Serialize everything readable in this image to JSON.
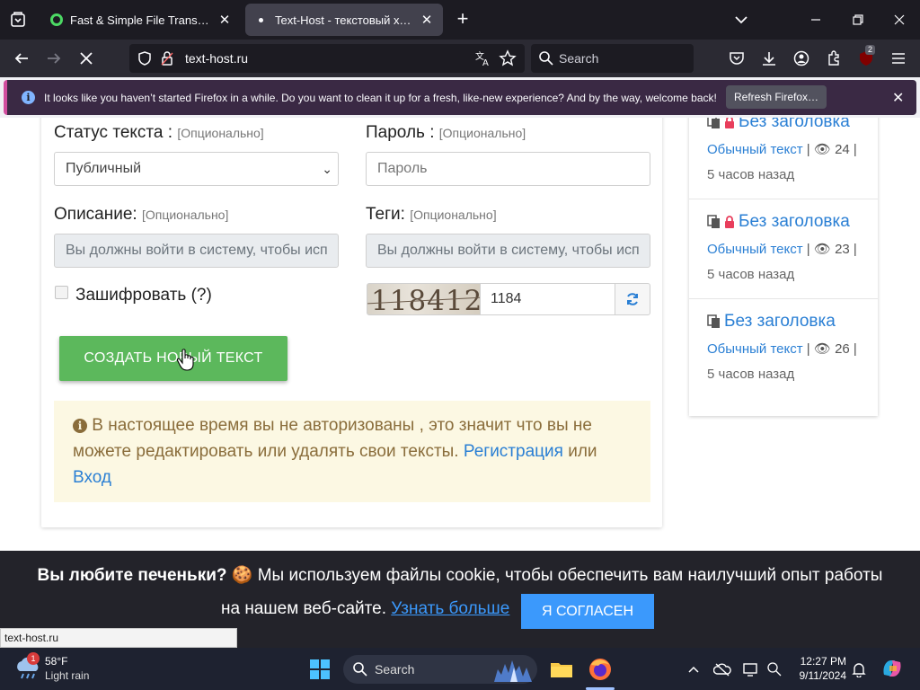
{
  "browser": {
    "tabs": [
      {
        "title": "Fast & Simple File Transfers - Fi",
        "active": false
      },
      {
        "title": "Text-Host - текстовый хостинг",
        "active": true
      }
    ],
    "url": "text-host.ru",
    "search_placeholder": "Search",
    "extension_badge": "2",
    "notification": {
      "message": "It looks like you haven’t started Firefox in a while. Do you want to clean it up for a fresh, like-new experience? And by the way, welcome back!",
      "button": "Refresh Firefox…"
    },
    "status_url": "text-host.ru"
  },
  "form": {
    "status_label": "Статус текста :",
    "status_optional": "[Опционально]",
    "status_value": "Публичный",
    "password_label": "Пароль :",
    "password_optional": "[Опционально]",
    "password_placeholder": "Пароль",
    "description_label": "Описание:",
    "description_optional": "[Опционально]",
    "description_placeholder": "Вы должны войти в систему, чтобы исп",
    "tags_label": "Теги:",
    "tags_optional": "[Опционально]",
    "tags_placeholder": "Вы должны войти в систему, чтобы исп",
    "encrypt_label": "Зашифровать",
    "encrypt_help": "(?)",
    "captcha_text": "118412",
    "captcha_value": "1184",
    "submit_label": "СОЗДАТЬ НОВЫЙ ТЕКСТ"
  },
  "alert": {
    "text": " В настоящее время вы не авторизованы , это значит что вы не можете редактировать или удалять свои тексты. ",
    "register_link": "Регистрация",
    "or": " или ",
    "login_link": "Вход"
  },
  "recent": [
    {
      "title": "Без заголовка",
      "locked": true,
      "type": "Обычный текст",
      "views": "24",
      "time": "5 часов назад"
    },
    {
      "title": "Без заголовка",
      "locked": true,
      "type": "Обычный текст",
      "views": "23",
      "time": "5 часов назад"
    },
    {
      "title": "Без заголовка",
      "locked": false,
      "type": "Обычный текст",
      "views": "26",
      "time": "5 часов назад"
    }
  ],
  "cookie": {
    "bold": "Вы любите печеньки?",
    "line1": " 🍪 Мы используем файлы cookie, чтобы обеспечить вам наилучший опыт работы",
    "line2": "на нашем веб-сайте. ",
    "learn_more": "Узнать больше",
    "agree": "Я СОГЛАСЕН"
  },
  "taskbar": {
    "weather_temp": "58°F",
    "weather_cond": "Light rain",
    "weather_badge": "1",
    "search_label": "Search",
    "time": "12:27 PM",
    "date": "9/11/2024"
  },
  "colors": {
    "accent_blue": "#2a7fd4",
    "success_green": "#5cb85c",
    "warning_bg": "#fcf8e3",
    "warning_text": "#8a6d3b",
    "cookie_button": "#3b99fc"
  }
}
